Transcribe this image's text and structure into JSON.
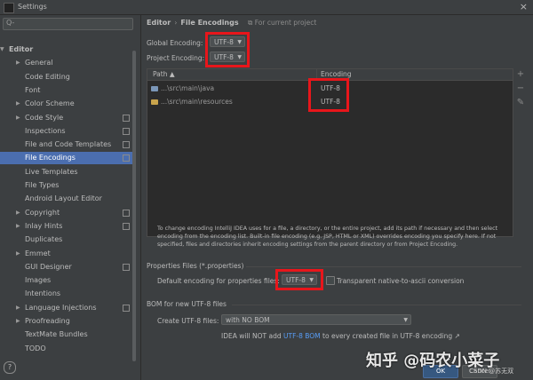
{
  "window": {
    "title": "Settings",
    "close_glyph": "×"
  },
  "sidebar": {
    "search_glyph": "Q-",
    "items": [
      {
        "label": "Editor",
        "level": 0,
        "arrow": "▼",
        "selected": false,
        "project": false
      },
      {
        "label": "General",
        "level": 1,
        "arrow": "▶",
        "selected": false,
        "project": false
      },
      {
        "label": "Code Editing",
        "level": 1,
        "arrow": "",
        "selected": false,
        "project": false
      },
      {
        "label": "Font",
        "level": 1,
        "arrow": "",
        "selected": false,
        "project": false
      },
      {
        "label": "Color Scheme",
        "level": 1,
        "arrow": "▶",
        "selected": false,
        "project": false
      },
      {
        "label": "Code Style",
        "level": 1,
        "arrow": "▶",
        "selected": false,
        "project": true
      },
      {
        "label": "Inspections",
        "level": 1,
        "arrow": "",
        "selected": false,
        "project": true
      },
      {
        "label": "File and Code Templates",
        "level": 1,
        "arrow": "",
        "selected": false,
        "project": true
      },
      {
        "label": "File Encodings",
        "level": 1,
        "arrow": "",
        "selected": true,
        "project": true
      },
      {
        "label": "Live Templates",
        "level": 1,
        "arrow": "",
        "selected": false,
        "project": false
      },
      {
        "label": "File Types",
        "level": 1,
        "arrow": "",
        "selected": false,
        "project": false
      },
      {
        "label": "Android Layout Editor",
        "level": 1,
        "arrow": "",
        "selected": false,
        "project": false
      },
      {
        "label": "Copyright",
        "level": 1,
        "arrow": "▶",
        "selected": false,
        "project": true
      },
      {
        "label": "Inlay Hints",
        "level": 1,
        "arrow": "▶",
        "selected": false,
        "project": true
      },
      {
        "label": "Duplicates",
        "level": 1,
        "arrow": "",
        "selected": false,
        "project": false
      },
      {
        "label": "Emmet",
        "level": 1,
        "arrow": "▶",
        "selected": false,
        "project": false
      },
      {
        "label": "GUI Designer",
        "level": 1,
        "arrow": "",
        "selected": false,
        "project": true
      },
      {
        "label": "Images",
        "level": 1,
        "arrow": "",
        "selected": false,
        "project": false
      },
      {
        "label": "Intentions",
        "level": 1,
        "arrow": "",
        "selected": false,
        "project": false
      },
      {
        "label": "Language Injections",
        "level": 1,
        "arrow": "▶",
        "selected": false,
        "project": true
      },
      {
        "label": "Proofreading",
        "level": 1,
        "arrow": "▶",
        "selected": false,
        "project": false
      },
      {
        "label": "TextMate Bundles",
        "level": 1,
        "arrow": "",
        "selected": false,
        "project": false
      },
      {
        "label": "TODO",
        "level": 1,
        "arrow": "",
        "selected": false,
        "project": false
      }
    ]
  },
  "breadcrumb": {
    "parent": "Editor",
    "separator": "›",
    "current": "File Encodings"
  },
  "for_project": "For current project",
  "global_encoding": {
    "label": "Global Encoding:",
    "value": "UTF-8"
  },
  "project_encoding": {
    "label": "Project Encoding:",
    "value": "UTF-8"
  },
  "table": {
    "columns": [
      "Path",
      "Encoding"
    ],
    "sort_glyph": "▲",
    "rows": [
      {
        "path": "...\\src\\main\\java",
        "encoding": "UTF-8"
      },
      {
        "path": "...\\src\\main\\resources",
        "encoding": "UTF-8"
      }
    ],
    "buttons": {
      "add": "+",
      "remove": "−",
      "edit": "✎"
    }
  },
  "info_text": "To change encoding IntelliJ IDEA uses for a file, a directory, or the entire project, add its path if necessary and then select encoding from the encoding list. Built-in file encoding (e.g. JSP, HTML or XML) overrides encoding you specify here. If not specified, files and directories inherit encoding settings from the parent directory or from Project Encoding.",
  "properties": {
    "section": "Properties Files (*.properties)",
    "label": "Default encoding for properties files:",
    "value": "UTF-8",
    "checkbox_label": "Transparent native-to-ascii conversion"
  },
  "bom": {
    "section": "BOM for new UTF-8 files",
    "label": "Create UTF-8 files:",
    "value": "with NO BOM",
    "note_prefix": "IDEA will NOT add",
    "note_link": "UTF-8 BOM",
    "note_suffix": "to every created file in UTF-8 encoding ↗"
  },
  "footer": {
    "ok": "OK",
    "cancel": "Cancel",
    "help": "?"
  },
  "watermark": "知乎 @码农小菜子",
  "csdn_mark": "CSDN @苏无双",
  "colors": {
    "accent_selection": "#4b6eaf",
    "highlight_box": "#e8161b",
    "link": "#589df6"
  }
}
